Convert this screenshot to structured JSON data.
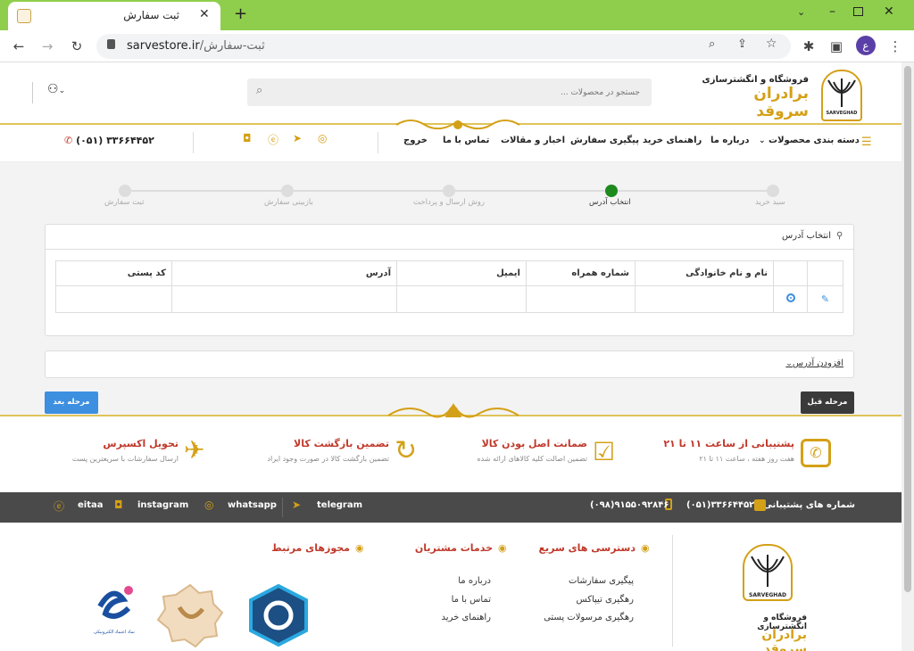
{
  "browser": {
    "tab_title": "ثبت سفارش",
    "url_host": "sarvestore.ir",
    "url_path": "/ثبت-سفارش",
    "profile_initial": "ع"
  },
  "header": {
    "store_line1": "فروشگاه و انگشترسازی",
    "store_line2": "برادران سروقد",
    "logo_text": "SARVEGHAD",
    "search_placeholder": "جستجو در محصولات ..."
  },
  "nav": {
    "items": [
      "دسته بندی محصولات",
      "درباره ما",
      "راهنمای خرید",
      "پیگیری سفارش",
      "اخبار و مقالات",
      "تماس با ما",
      "خروج"
    ],
    "phone": "(۰۵۱) ۳۳۶۶۴۴۵۲"
  },
  "steps": {
    "labels": [
      "سبد خرید",
      "انتخاب آدرس",
      "روش ارسال و پرداخت",
      "بازبینی سفارش",
      "ثبت سفارش"
    ],
    "active_index": 1
  },
  "address": {
    "title": "انتخاب آدرس",
    "columns": [
      "نام و نام خانوادگی",
      "شماره همراه",
      "ایمیل",
      "آدرس",
      "کد پستی"
    ],
    "add_label": "افزودن آدرس"
  },
  "buttons": {
    "prev": "مرحله قبل",
    "next": "مرحله بعد"
  },
  "features": [
    {
      "title": "پشتیبانی از ساعت ۱۱ تا ۲۱",
      "sub": "هفت روز هفته ، ساعت ۱۱ تا ۲۱"
    },
    {
      "title": "ضمانت اصل بودن کالا",
      "sub": "تضمین اصالت کلیه کالاهای ارائه شده"
    },
    {
      "title": "تضمین بازگشت کالا",
      "sub": "تضمین بازگشت کالا در صورت وجود ایراد"
    },
    {
      "title": "تحویل اکسپرس",
      "sub": "ارسال سفارشات با سریعترین پست"
    }
  ],
  "support_bar": {
    "label": "شماره های پشتیبانی:",
    "phone1": "(۰۵۱)۳۳۶۶۴۴۵۲",
    "phone2": "(۰۹۸)۹۱۵۵۰۹۲۸۴۶",
    "socials": [
      "telegram",
      "whatsapp",
      "instagram",
      "eitaa"
    ]
  },
  "footer": {
    "quick_title": "دسترسی های سریع",
    "quick_links": [
      "پیگیری سفارشات",
      "رهگیری تیپاکس",
      "رهگیری مرسولات پستی"
    ],
    "service_title": "خدمات مشتریان",
    "service_links": [
      "درباره ما",
      "تماس با ما",
      "راهنمای خرید"
    ],
    "license_title": "مجوزهای مرتبط",
    "enamad_text": "نماد اعتماد الکترونیکی"
  },
  "colors": {
    "accent_gold": "#d4a017",
    "accent_red": "#c0392b",
    "step_active": "#1e8a1e",
    "next_button": "#3d8fe0",
    "prev_button": "#3a3a3a",
    "support_bar": "#4a4a4a",
    "browser_bar": "#8fce4c"
  }
}
